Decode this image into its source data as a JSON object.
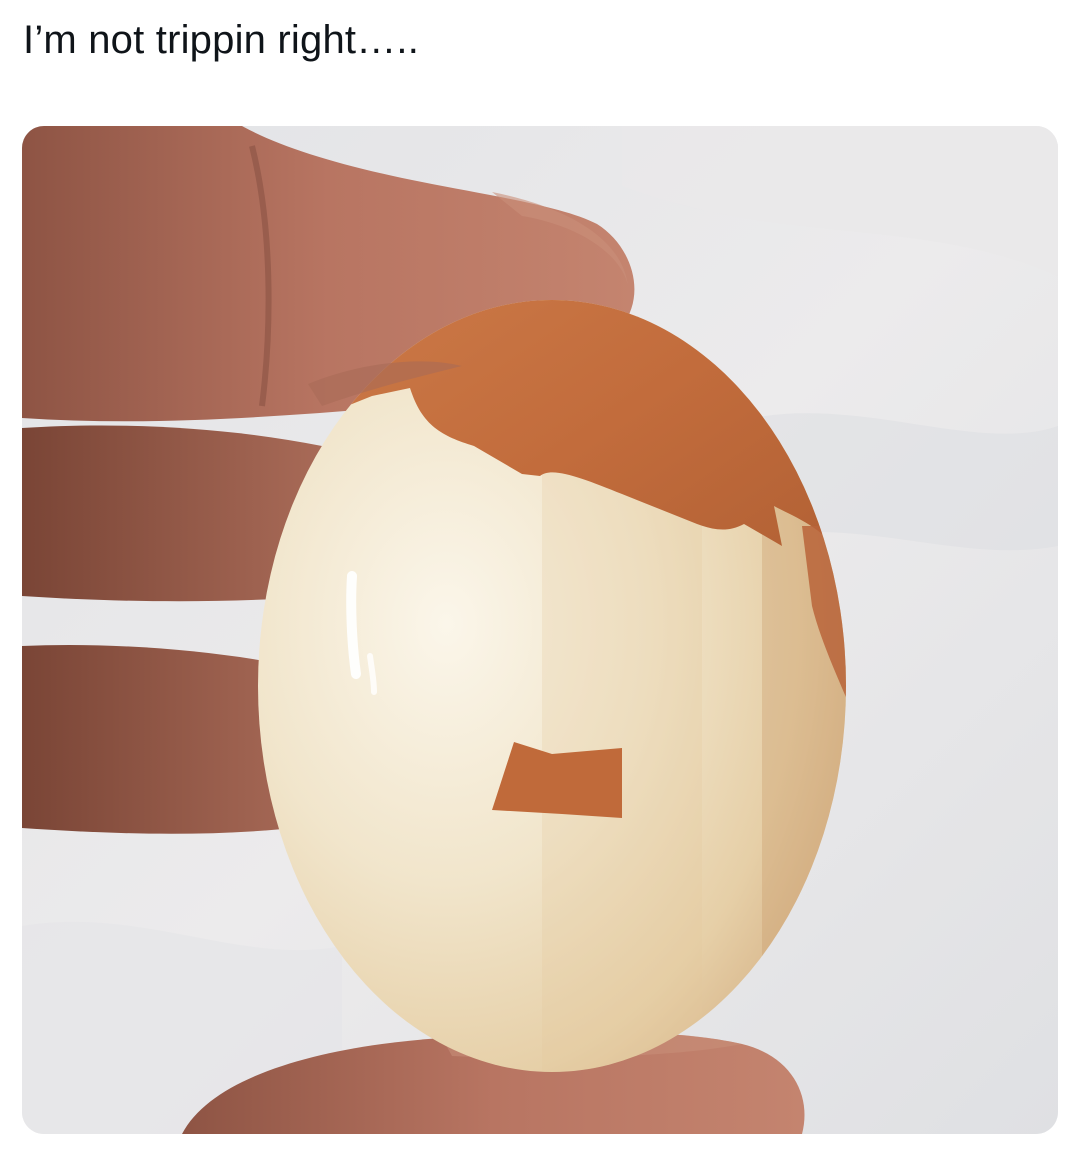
{
  "post": {
    "caption": "I’m not trippin right….."
  },
  "media": {
    "subject_icon": "peeled-egg-photo",
    "colors": {
      "background": "#e6e6e8",
      "skin": "#b8735f",
      "shell": "#c4703f",
      "egg_white": "#f3ead6"
    }
  }
}
